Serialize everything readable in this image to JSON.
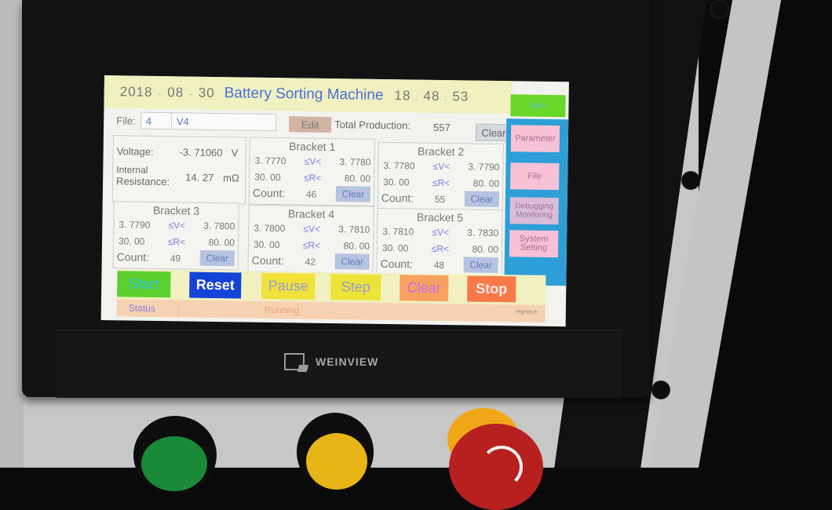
{
  "hmi": {
    "header": {
      "date": {
        "year": "2018",
        "month": "08",
        "day": "30",
        "separator": "-"
      },
      "title": "Battery Sorting Machine",
      "time": {
        "hour": "18",
        "minute": "48",
        "second": "53",
        "separator": ":"
      },
      "run_indicator": "RUN"
    },
    "file_row": {
      "label": "File:",
      "number": "4",
      "name": "V4",
      "edit_label": "Edit",
      "total_label": "Total Production:",
      "total_value": "557",
      "clear_label": "Clear"
    },
    "measurement": {
      "voltage_label": "Voltage:",
      "voltage_value": "-3. 71060",
      "voltage_unit": "V",
      "resistance_label_1": "Internal",
      "resistance_label_2": "Resistance:",
      "resistance_value": "14. 27",
      "resistance_unit": "mΩ"
    },
    "brackets": [
      {
        "title": "Bracket 1",
        "v_min": "3. 7770",
        "v_op": "≤V<",
        "v_max": "3. 7780",
        "r_min": "30. 00",
        "r_op": "≤R<",
        "r_max": "80. 00",
        "count_label": "Count:",
        "count": "46",
        "clear_label": "Clear"
      },
      {
        "title": "Bracket 2",
        "v_min": "3. 7780",
        "v_op": "≤V<",
        "v_max": "3. 7790",
        "r_min": "30. 00",
        "r_op": "≤R<",
        "r_max": "80. 00",
        "count_label": "Count:",
        "count": "55",
        "clear_label": "Clear"
      },
      {
        "title": "Bracket 3",
        "v_min": "3. 7790",
        "v_op": "≤V<",
        "v_max": "3. 7800",
        "r_min": "30. 00",
        "r_op": "≤R<",
        "r_max": "80. 00",
        "count_label": "Count:",
        "count": "49",
        "clear_label": "Clear"
      },
      {
        "title": "Bracket 4",
        "v_min": "3. 7800",
        "v_op": "≤V<",
        "v_max": "3. 7810",
        "r_min": "30. 00",
        "r_op": "≤R<",
        "r_max": "80. 00",
        "count_label": "Count:",
        "count": "42",
        "clear_label": "Clear"
      },
      {
        "title": "Bracket 5",
        "v_min": "3. 7810",
        "v_op": "≤V<",
        "v_max": "3. 7830",
        "r_min": "30. 00",
        "r_op": "≤R<",
        "r_max": "80. 00",
        "count_label": "Count:",
        "count": "48",
        "clear_label": "Clear"
      }
    ],
    "sidebar": {
      "items": [
        {
          "label": "Parameter"
        },
        {
          "label": "File"
        },
        {
          "label": "Debugging Monitoring"
        },
        {
          "label": "System Setting"
        }
      ]
    },
    "controls": {
      "start": {
        "label": "Start",
        "bg": "#5ccf2e",
        "color": "#2bc0d8"
      },
      "reset": {
        "label": "Reset",
        "bg": "#1443d8",
        "color": "#ffffff"
      },
      "pause": {
        "label": "Pause",
        "bg": "#f0e23a",
        "color": "#9a9ad8"
      },
      "step": {
        "label": "Step",
        "bg": "#ece438",
        "color": "#9a9ad8"
      },
      "clear": {
        "label": "Clear",
        "bg": "#f8a060",
        "color": "#c070e8"
      },
      "stop": {
        "label": "Stop",
        "bg": "#f87848",
        "color": "#ffe8e8"
      }
    },
    "status": {
      "label": "Status",
      "value": "Running",
      "vendor_logo": "Hightech"
    }
  },
  "device": {
    "brand": "WEINVIEW"
  }
}
